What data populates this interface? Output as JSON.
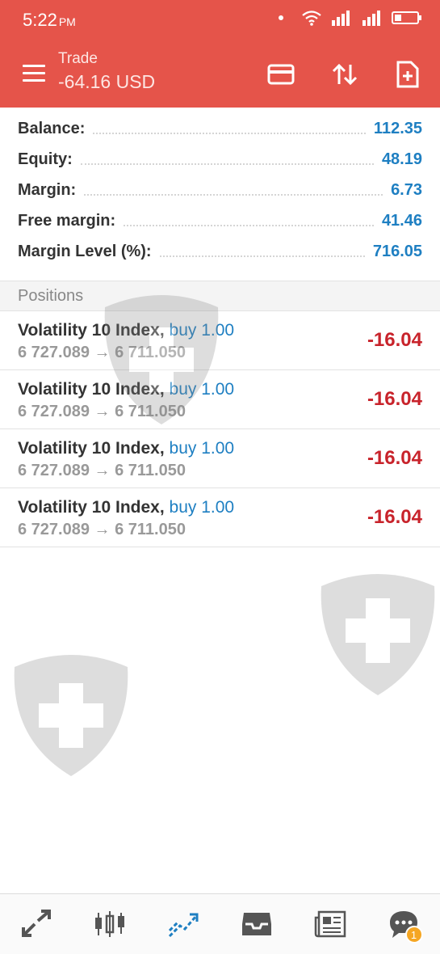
{
  "status_bar": {
    "time": "5:22",
    "ampm": "PM"
  },
  "header": {
    "title": "Trade",
    "subtitle": "-64.16 USD"
  },
  "account": [
    {
      "label": "Balance:",
      "value": "112.35"
    },
    {
      "label": "Equity:",
      "value": "48.19"
    },
    {
      "label": "Margin:",
      "value": "6.73"
    },
    {
      "label": "Free margin:",
      "value": "41.46"
    },
    {
      "label": "Margin Level (%):",
      "value": "716.05"
    }
  ],
  "positions_title": "Positions",
  "positions": [
    {
      "symbol": "Volatility 10 Index,",
      "side": "buy 1.00",
      "prices": "6 727.089 → 6 711.050",
      "profit": "-16.04"
    },
    {
      "symbol": "Volatility 10 Index,",
      "side": "buy 1.00",
      "prices": "6 727.089 → 6 711.050",
      "profit": "-16.04"
    },
    {
      "symbol": "Volatility 10 Index,",
      "side": "buy 1.00",
      "prices": "6 727.089 → 6 711.050",
      "profit": "-16.04"
    },
    {
      "symbol": "Volatility 10 Index,",
      "side": "buy 1.00",
      "prices": "6 727.089 → 6 711.050",
      "profit": "-16.04"
    }
  ],
  "bottom_nav": {
    "items": [
      {
        "icon": "quotes-icon"
      },
      {
        "icon": "chart-icon"
      },
      {
        "icon": "trade-icon",
        "active": true
      },
      {
        "icon": "history-icon"
      },
      {
        "icon": "news-icon"
      },
      {
        "icon": "chat-icon",
        "badge": "1"
      }
    ]
  },
  "colors": {
    "header": "#e5544a",
    "accent": "#1e7fc2",
    "loss": "#c8232b",
    "badge": "#f5a623"
  }
}
